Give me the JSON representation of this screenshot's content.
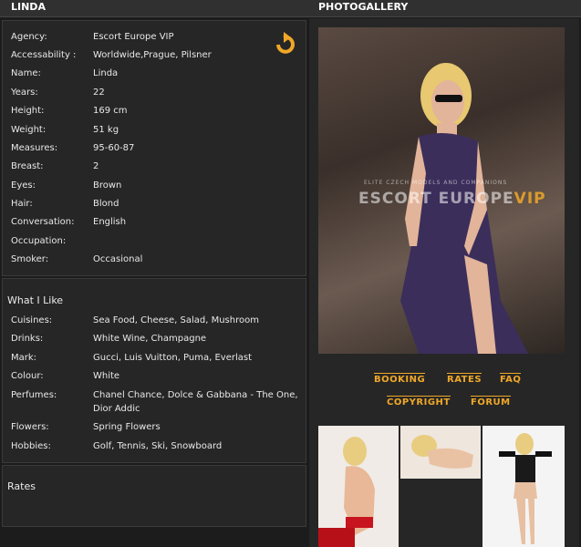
{
  "left_header": "Linda",
  "right_header": "Photogallery",
  "profile": [
    {
      "label": "Agency:",
      "value": "Escort Europe VIP"
    },
    {
      "label": "Accessability :",
      "value": "Worldwide,Prague, Pilsner"
    },
    {
      "label": "Name:",
      "value": "Linda"
    },
    {
      "label": "Years:",
      "value": "22"
    },
    {
      "label": "Height:",
      "value": "169 cm"
    },
    {
      "label": "Weight:",
      "value": "51 kg"
    },
    {
      "label": "Measures:",
      "value": "95-60-87"
    },
    {
      "label": "Breast:",
      "value": "2"
    },
    {
      "label": "Eyes:",
      "value": "Brown"
    },
    {
      "label": "Hair:",
      "value": "Blond"
    },
    {
      "label": "Conversation:",
      "value": "English"
    },
    {
      "label": "Occupation:",
      "value": ""
    },
    {
      "label": "Smoker:",
      "value": "Occasional"
    }
  ],
  "likes_title": "What I Like",
  "likes": [
    {
      "label": "Cuisines:",
      "value": "Sea Food, Cheese, Salad, Mushroom"
    },
    {
      "label": "Drinks:",
      "value": "White Wine, Champagne"
    },
    {
      "label": "Mark:",
      "value": "Gucci, Luis Vuitton, Puma, Everlast"
    },
    {
      "label": "Colour:",
      "value": "White"
    },
    {
      "label": "Perfumes:",
      "value": "Chanel Chance, Dolce & Gabbana - The One,",
      "value2": "Dior Addic"
    },
    {
      "label": "Flowers:",
      "value": "Spring Flowers"
    },
    {
      "label": "Hobbies:",
      "value": "Golf, Tennis, Ski, Snowboard"
    }
  ],
  "rates_title": "Rates",
  "watermark": {
    "sub": "ELITE CZECH MODELS AND COMPANIONS",
    "main": "ESCORT EUROPE",
    "vip": "VIP"
  },
  "links": {
    "booking": "BOOKING",
    "rates": "RATES",
    "faq": "FAQ",
    "copyright": "COPYRIGHT",
    "forum": "FORUM"
  },
  "colors": {
    "accent": "#f0a828",
    "panel": "#262626",
    "background": "#1c1c1c"
  },
  "icons": {
    "back": "undo-arrow-icon"
  }
}
